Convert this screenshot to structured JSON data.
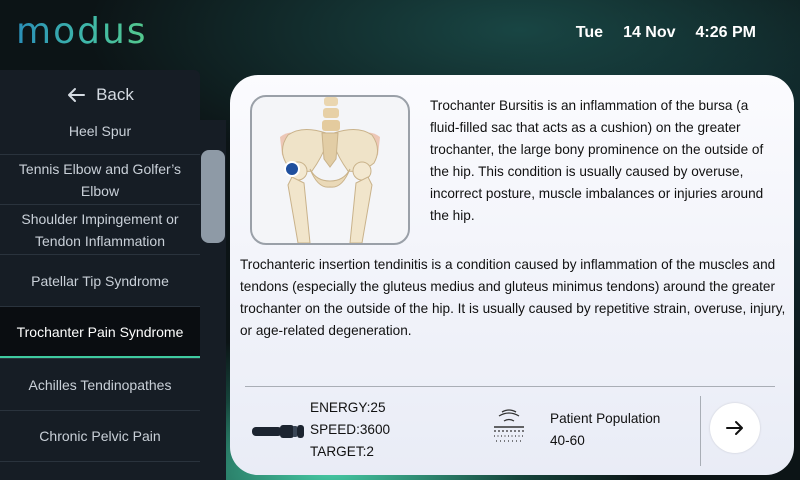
{
  "app": {
    "logo": "modus"
  },
  "clock": {
    "day": "Tue",
    "date": "14 Nov",
    "time": "4:26 PM"
  },
  "sidebar": {
    "back_label": "Back",
    "items": [
      {
        "label": "Heel Spur"
      },
      {
        "label": "Tennis Elbow and Golfer’s Elbow"
      },
      {
        "label": "Shoulder Impingement or Tendon Inflammation"
      },
      {
        "label": "Patellar Tip Syndrome"
      },
      {
        "label": "Trochanter Pain Syndrome",
        "active": true
      },
      {
        "label": "Achilles Tendinopathes"
      },
      {
        "label": "Chronic Pelvic Pain"
      }
    ]
  },
  "content": {
    "paragraph1": "Trochanter Bursitis is an inflammation of the bursa (a fluid-filled sac that acts as a cushion) on the greater trochanter, the large bony prominence on the outside of the hip. This condition is usually caused by overuse, incorrect posture, muscle imbalances or injuries around the hip.",
    "paragraph2": "Trochanteric insertion tendinitis is a condition caused by inflammation of the muscles and tendons (especially the gluteus medius and gluteus minimus tendons) around the greater trochanter on the outside of the hip. It is usually caused by repetitive strain, overuse, injury, or age-related degeneration."
  },
  "footer": {
    "energy": "ENERGY:25",
    "speed": "SPEED:3600",
    "target": "TARGET:2",
    "population_label": "Patient Population",
    "population_value": "40-60"
  },
  "icons": {
    "back": "arrow-left-icon",
    "applicator": "applicator-icon",
    "wave": "shockwave-icon",
    "next": "arrow-right-icon"
  },
  "colors": {
    "accent": "#3fcaa0",
    "marker": "#1f4f9e",
    "sidebar_bg": "#161d25"
  }
}
